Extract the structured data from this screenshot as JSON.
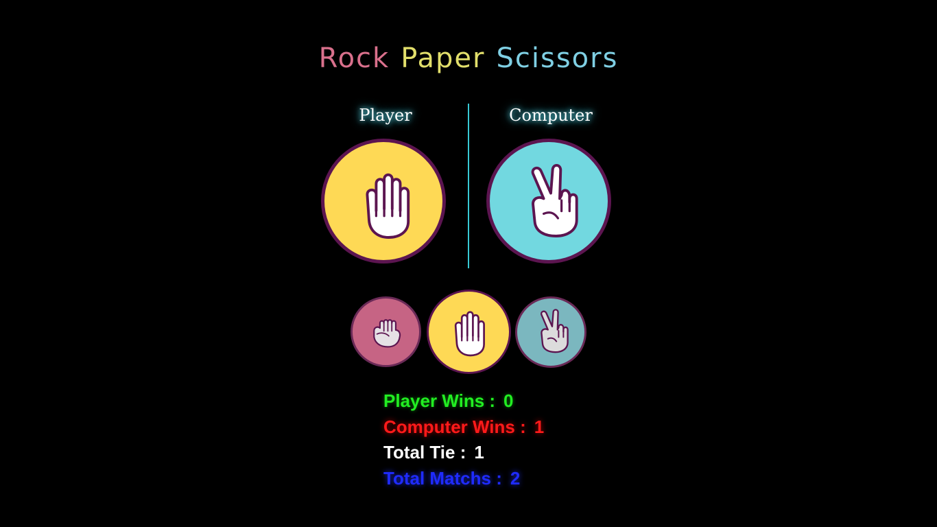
{
  "title": {
    "word1": "Rock",
    "word2": "Paper",
    "word3": "Scissors",
    "colors": [
      "#d9708c",
      "#e2df6b",
      "#7fcfe3"
    ]
  },
  "arena": {
    "player_label": "Player",
    "computer_label": "Computer",
    "player_choice_icon": "paper-hand-icon",
    "computer_choice_icon": "scissors-hand-icon"
  },
  "options": [
    {
      "icon": "rock-fist-icon",
      "selected": false
    },
    {
      "icon": "paper-hand-icon",
      "selected": true
    },
    {
      "icon": "scissors-hand-icon",
      "selected": false
    }
  ],
  "scores": {
    "player_wins_label": "Player Wins :",
    "player_wins_value": "0",
    "computer_wins_label": "Computer Wins :",
    "computer_wins_value": "1",
    "total_tie_label": "Total Tie :",
    "total_tie_value": "1",
    "total_matches_label": "Total Matchs :",
    "total_matches_value": "2"
  },
  "colors": {
    "background": "#000000",
    "paper": "#fed955",
    "scissors": "#72d8e0",
    "rock": "#c66484",
    "outline": "#5c1550",
    "player_wins": "#22ee22",
    "computer_wins": "#ff1a1a",
    "tie": "#ffffff",
    "total": "#1f2bff"
  }
}
